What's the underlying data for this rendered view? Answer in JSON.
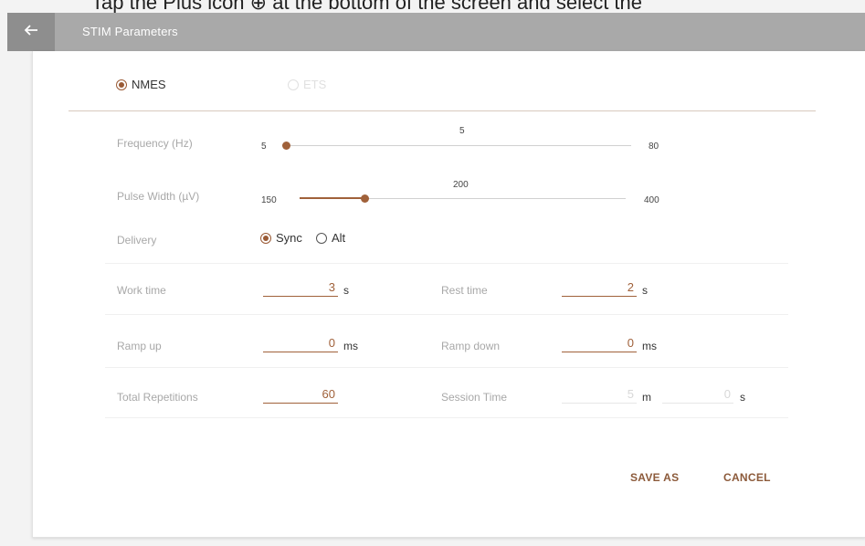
{
  "caption": {
    "text": "Tap the Plus icon ⊕ at the bottom of the screen and select the"
  },
  "header": {
    "back_icon": "arrow-left-icon",
    "title": "STIM Parameters"
  },
  "mode": {
    "options": [
      {
        "label": "NMES",
        "selected": true,
        "enabled": true
      },
      {
        "label": "ETS",
        "selected": false,
        "enabled": false
      }
    ]
  },
  "frequency": {
    "label": "Frequency (Hz)",
    "min": "5",
    "max": "80",
    "value": "5",
    "fraction": 0.0
  },
  "pulse_width": {
    "label": "Pulse Width (µV)",
    "min": "150",
    "max": "400",
    "value": "200",
    "fraction": 0.2
  },
  "delivery": {
    "label": "Delivery",
    "options": [
      {
        "label": "Sync",
        "selected": true
      },
      {
        "label": "Alt",
        "selected": false
      }
    ]
  },
  "work_time": {
    "label": "Work time",
    "value": "3",
    "unit": "s"
  },
  "rest_time": {
    "label": "Rest time",
    "value": "2",
    "unit": "s"
  },
  "ramp_up": {
    "label": "Ramp up",
    "value": "0",
    "unit": "ms"
  },
  "ramp_down": {
    "label": "Ramp down",
    "value": "0",
    "unit": "ms"
  },
  "total_repetitions": {
    "label": "Total Repetitions",
    "value": "60"
  },
  "session_time": {
    "label": "Session Time",
    "minutes": "5",
    "minutes_unit": "m",
    "seconds": "0",
    "seconds_unit": "s"
  },
  "actions": {
    "save_as": "SAVE AS",
    "cancel": "CANCEL"
  },
  "colors": {
    "accent": "#a0613a",
    "appbar": "#a9a9a9",
    "back_button": "#8e8e8e"
  }
}
